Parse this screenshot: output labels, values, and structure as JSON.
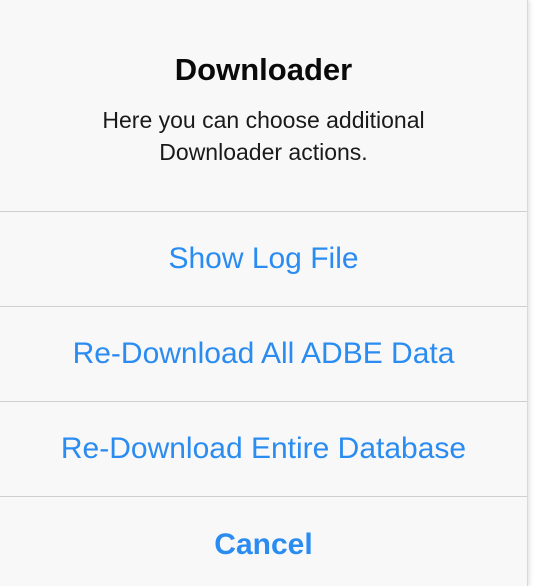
{
  "dialog": {
    "title": "Downloader",
    "message": "Here you can choose additional Downloader actions.",
    "actions": [
      {
        "label": "Show Log File"
      },
      {
        "label": "Re-Download All ADBE Data"
      },
      {
        "label": "Re-Download Entire Database"
      }
    ],
    "cancel_label": "Cancel"
  },
  "colors": {
    "accent": "#2a8cf1",
    "sheet_background": "#f8f8f9",
    "separator": "#cfcfd3"
  }
}
